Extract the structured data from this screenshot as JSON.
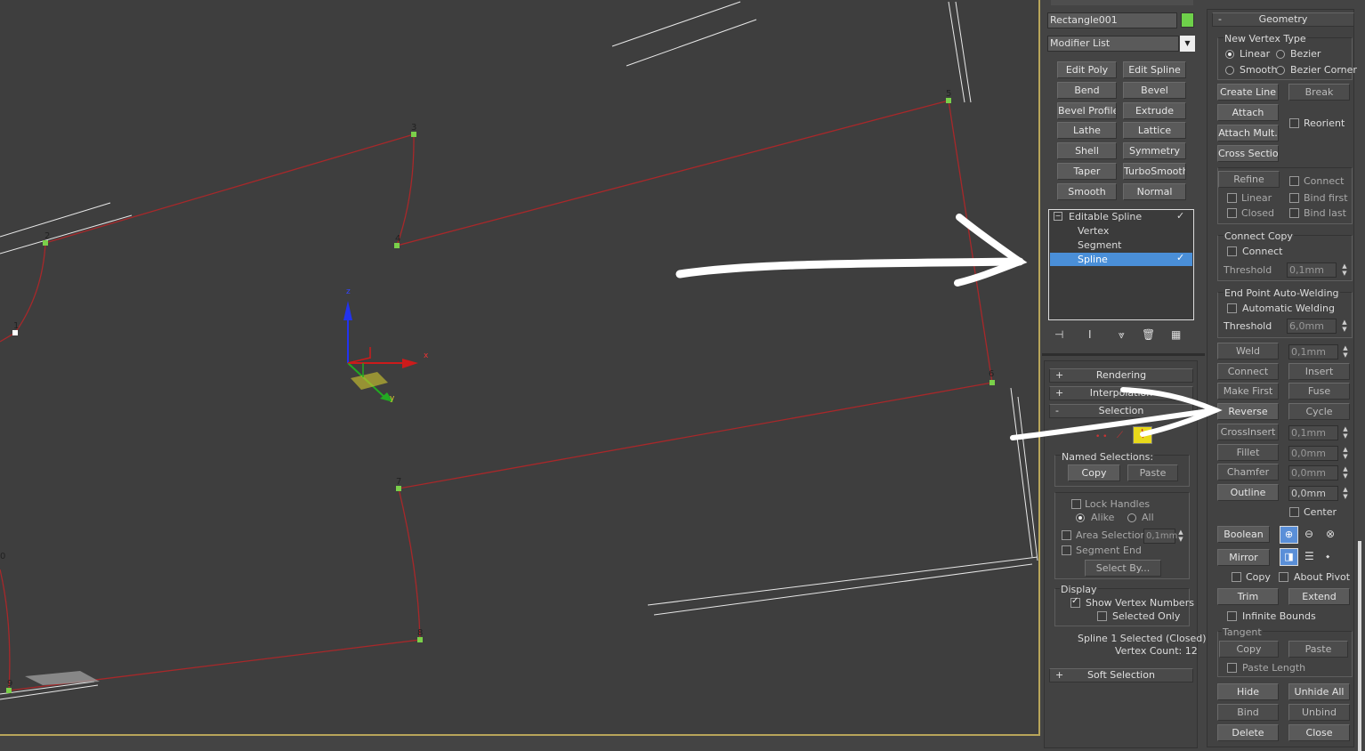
{
  "viewport": {
    "vertex_labels": [
      "0",
      "1",
      "2",
      "3",
      "4",
      "5",
      "6",
      "7",
      "8",
      "9"
    ],
    "gizmo_axes": {
      "z": "z",
      "x": "x",
      "y": "y"
    }
  },
  "modifier_panel": {
    "object_name": "Rectangle001",
    "object_color": "#6ed04a",
    "modifier_list": "Modifier List",
    "modifier_buttons": [
      "Edit Poly",
      "Edit Spline",
      "Bend",
      "Bevel",
      "Bevel Profile",
      "Extrude",
      "Lathe",
      "Lattice",
      "Shell",
      "Symmetry",
      "Taper",
      "TurboSmooth",
      "Smooth",
      "Normal"
    ],
    "stack": {
      "root": "Editable Spline",
      "items": [
        "Vertex",
        "Segment",
        "Spline"
      ],
      "selected": "Spline"
    },
    "rollouts": {
      "rendering": "Rendering",
      "interpolation": "Interpolation",
      "selection": "Selection",
      "soft_selection": "Soft Selection"
    },
    "selection": {
      "named_selections": "Named Selections:",
      "copy": "Copy",
      "paste": "Paste",
      "lock_handles": "Lock Handles",
      "alike": "Alike",
      "all": "All",
      "area_selection": "Area Selection:",
      "area_value": "0,1mm",
      "segment_end": "Segment End",
      "select_by": "Select By...",
      "display": "Display",
      "show_vertex_numbers": "Show Vertex Numbers",
      "selected_only": "Selected Only",
      "status_line1": "Spline 1 Selected (Closed)",
      "status_line2": "Vertex Count: 12"
    }
  },
  "geometry_panel": {
    "title": "Geometry",
    "new_vertex_type": "New Vertex Type",
    "linear": "Linear",
    "bezier": "Bezier",
    "smooth": "Smooth",
    "bezier_corner": "Bezier Corner",
    "create_line": "Create Line",
    "break": "Break",
    "attach": "Attach",
    "reorient": "Reorient",
    "attach_mult": "Attach Mult.",
    "cross_section": "Cross Section",
    "refine": "Refine",
    "connect": "Connect",
    "refine_linear": "Linear",
    "bind_first": "Bind first",
    "closed": "Closed",
    "bind_last": "Bind last",
    "connect_copy": "Connect Copy",
    "cc_connect": "Connect",
    "threshold": "Threshold",
    "cc_threshold": "0,1mm",
    "end_point": "End Point Auto-Welding",
    "automatic_welding": "Automatic Welding",
    "ep_threshold": "6,0mm",
    "weld": "Weld",
    "weld_value": "0,1mm",
    "connect_btn": "Connect",
    "insert": "Insert",
    "make_first": "Make First",
    "fuse": "Fuse",
    "reverse": "Reverse",
    "cycle": "Cycle",
    "crossinsert": "CrossInsert",
    "crossinsert_value": "0,1mm",
    "fillet": "Fillet",
    "fillet_value": "0,0mm",
    "chamfer": "Chamfer",
    "chamfer_value": "0,0mm",
    "outline": "Outline",
    "outline_value": "0,0mm",
    "center": "Center",
    "boolean": "Boolean",
    "mirror": "Mirror",
    "copy": "Copy",
    "about_pivot": "About Pivot",
    "trim": "Trim",
    "extend": "Extend",
    "infinite_bounds": "Infinite Bounds",
    "tangent": "Tangent",
    "t_copy": "Copy",
    "t_paste": "Paste",
    "paste_length": "Paste Length",
    "hide": "Hide",
    "unhide_all": "Unhide All",
    "bind": "Bind",
    "unbind": "Unbind",
    "delete": "Delete",
    "close": "Close"
  }
}
